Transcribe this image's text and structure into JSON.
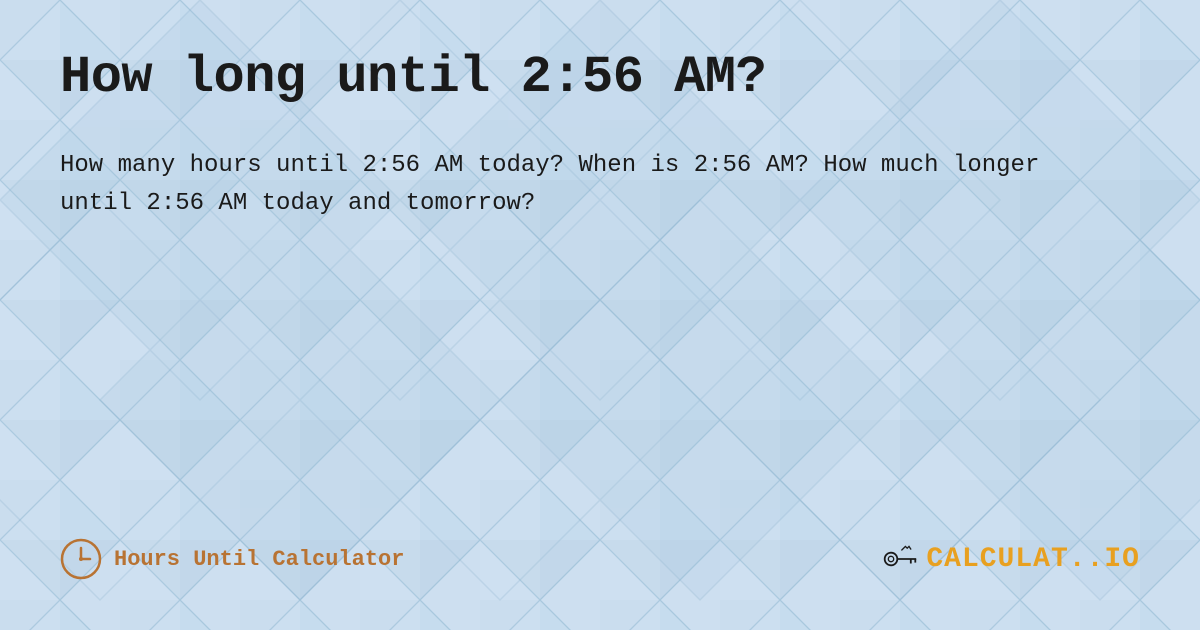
{
  "page": {
    "title": "How long until 2:56 AM?",
    "description": "How many hours until 2:56 AM today? When is 2:56 AM? How much longer until 2:56 AM today and tomorrow?",
    "footer": {
      "left_label": "Hours Until Calculator",
      "right_brand_prefix": "CALCULAT",
      "right_brand_suffix": ".IO"
    },
    "colors": {
      "background": "#c8dff0",
      "title": "#1a1a1a",
      "description": "#1a1a1a",
      "hours_label": "#b87333",
      "brand": "#1a1a1a",
      "brand_dot": "#e8a020"
    }
  }
}
